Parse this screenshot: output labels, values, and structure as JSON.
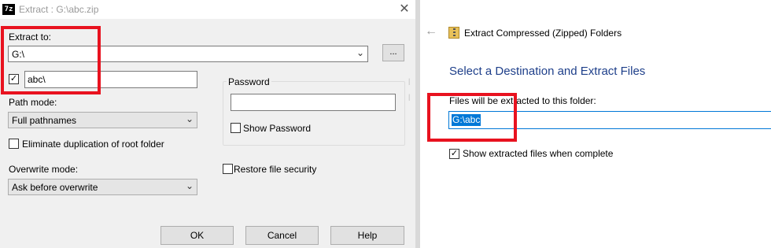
{
  "sevenzip": {
    "window_title": "Extract : G:\\abc.zip",
    "app_icon_text": "7z",
    "extract_to_label": "Extract to:",
    "extract_to_value": "G:\\",
    "browse_label": "...",
    "subfolder_checked": true,
    "subfolder_value": "abc\\",
    "path_mode_label": "Path mode:",
    "path_mode_value": "Full pathnames",
    "eliminate_duplication_label": "Eliminate duplication of root folder",
    "overwrite_mode_label": "Overwrite mode:",
    "overwrite_mode_value": "Ask before overwrite",
    "password_group_label": "Password",
    "password_value": "",
    "show_password_label": "Show Password",
    "restore_security_label": "Restore file security",
    "buttons": {
      "ok": "OK",
      "cancel": "Cancel",
      "help": "Help"
    }
  },
  "windows_wizard": {
    "title": "Extract Compressed (Zipped) Folders",
    "heading": "Select a Destination and Extract Files",
    "destination_label": "Files will be extracted to this folder:",
    "destination_value": "G:\\abc",
    "show_extracted_label": "Show extracted files when complete",
    "show_extracted_checked": true
  },
  "icons": {
    "close": "close-icon",
    "chevron": "chevron-down-icon",
    "back": "back-arrow-icon",
    "checkbox_mark": "checkmark-icon",
    "zip_folder": "zip-folder-icon"
  },
  "colors": {
    "highlight_box": "#e8121f",
    "selection": "#0078d7",
    "heading": "#1e3f8a",
    "dialog_bg": "#f0f0f0"
  }
}
